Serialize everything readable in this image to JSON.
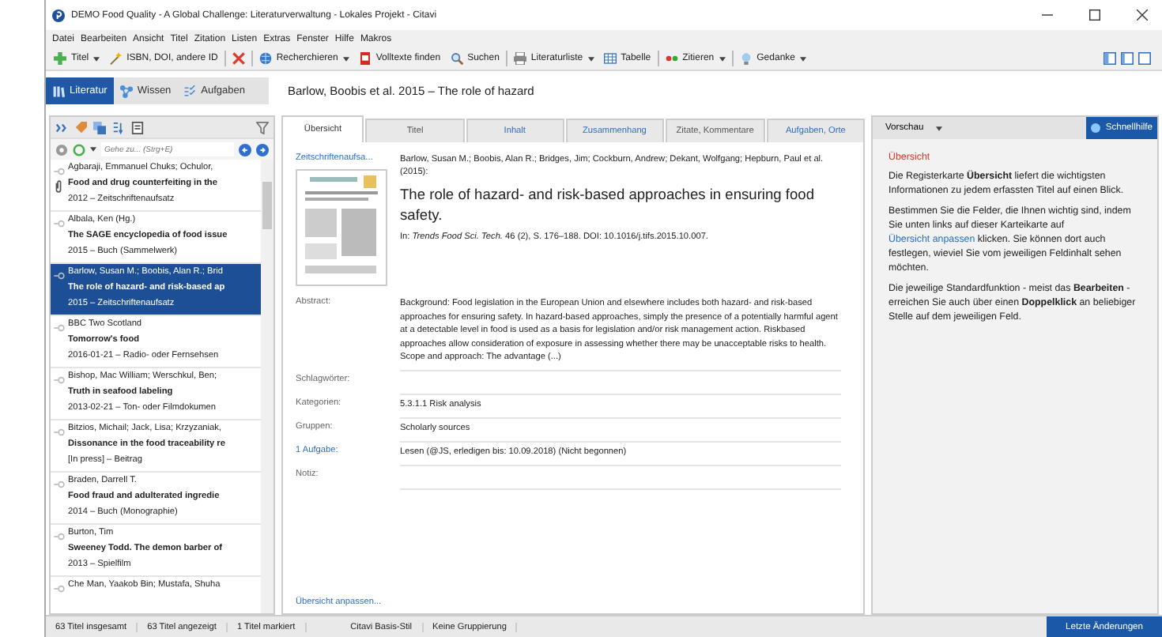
{
  "window": {
    "title": "DEMO Food Quality - A Global Challenge: Literaturverwaltung - Lokales Projekt - Citavi"
  },
  "menu": [
    "Datei",
    "Bearbeiten",
    "Ansicht",
    "Titel",
    "Zitation",
    "Listen",
    "Extras",
    "Fenster",
    "Hilfe",
    "Makros"
  ],
  "toolbar": [
    {
      "label": "Titel",
      "dropdown": true
    },
    {
      "label": "ISBN, DOI, andere ID",
      "dropdown": false
    },
    {
      "dropdown": false
    },
    {
      "label": "Recherchieren",
      "dropdown": true
    },
    {
      "label": "Volltexte finden",
      "dropdown": false
    },
    {
      "label": "Suchen",
      "dropdown": false
    },
    {
      "label": "Literaturliste",
      "dropdown": true
    },
    {
      "label": "Tabelle",
      "dropdown": false
    },
    {
      "label": "Zitieren",
      "dropdown": true
    },
    {
      "label": "Gedanke",
      "dropdown": true
    }
  ],
  "sections": [
    {
      "label": "Literatur",
      "selected": true
    },
    {
      "label": "Wissen",
      "selected": false
    },
    {
      "label": "Aufgaben",
      "selected": false
    }
  ],
  "heading": "Barlow, Boobis et al. 2015 – The role of hazard",
  "search": {
    "placeholder": "Gehe zu... (Strg+E)"
  },
  "references": [
    {
      "author": "Agbaraji, Emmanuel Chuks; Ochulor,",
      "title": "Food and drug counterfeiting in the",
      "meta": "2012 – Zeitschriftenaufsatz",
      "attachment": true,
      "selected": false
    },
    {
      "author": "Albala, Ken (Hg.)",
      "title": "The SAGE encyclopedia of food issue",
      "meta": "2015 – Buch (Sammelwerk)",
      "attachment": false,
      "selected": false
    },
    {
      "author": "Barlow, Susan M.; Boobis, Alan R.; Brid",
      "title": "The role of hazard- and risk-based ap",
      "meta": "2015 – Zeitschriftenaufsatz",
      "attachment": false,
      "selected": true
    },
    {
      "author": "BBC Two Scotland",
      "title": "Tomorrow's food",
      "meta": "2016-01-21 – Radio- oder Fernsehsen",
      "attachment": false,
      "selected": false
    },
    {
      "author": "Bishop, Mac William; Werschkul, Ben;",
      "title": "Truth in seafood labeling",
      "meta": "2013-02-21 – Ton- oder Filmdokumen",
      "attachment": false,
      "selected": false
    },
    {
      "author": "Bitzios, Michail; Jack, Lisa; Krzyzaniak,",
      "title": "Dissonance in the food traceability re",
      "meta": "[In press] – Beitrag",
      "attachment": false,
      "selected": false
    },
    {
      "author": "Braden, Darrell T.",
      "title": "Food fraud and adulterated ingredie",
      "meta": "2014 – Buch (Monographie)",
      "attachment": false,
      "selected": false
    },
    {
      "author": "Burton, Tim",
      "title": "Sweeney Todd. The demon barber of",
      "meta": "2013 – Spielfilm",
      "attachment": false,
      "selected": false
    },
    {
      "author": "Che Man, Yaakob Bin; Mustafa, Shuha",
      "attachment": false,
      "selected": false
    }
  ],
  "tabs": [
    {
      "label": "Übersicht",
      "selected": true,
      "has_content": false
    },
    {
      "label": "Titel",
      "selected": false,
      "has_content": false
    },
    {
      "label": "Inhalt",
      "selected": false,
      "has_content": true
    },
    {
      "label": "Zusammenhang",
      "selected": false,
      "has_content": true
    },
    {
      "label": "Zitate, Kommentare",
      "selected": false,
      "has_content": false
    },
    {
      "label": "Aufgaben, Orte",
      "selected": false,
      "has_content": true
    }
  ],
  "overview": {
    "type_link": "Zeitschriftenaufsa...",
    "authors": "Barlow, Susan M.; Boobis, Alan R.; Bridges, Jim; Cockburn, Andrew; Dekant, Wolfgang; Hepburn, Paul et al. (2015):",
    "title": "The role of hazard- and risk-based approaches in ensuring food safety.",
    "source": "In: *Trends Food Sci. Tech.* 46 (2), S. 176–188. DOI: 10.1016/j.tifs.2015.10.007.",
    "fields": [
      {
        "label": "Abstract:",
        "value": "Background: Food legislation in the European Union and elsewhere includes both hazard- and risk-based approaches for ensuring safety. In hazard-based approaches, simply the presence of a potentially harmful agent at a detectable level in food is used as a basis for legislation and/or risk management action. Riskbased approaches allow consideration of exposure in assessing whether there may be unacceptable risks to health. Scope and approach: The advantage (...)",
        "link": false
      },
      {
        "label": "Schlagwörter:",
        "link": false
      },
      {
        "label": "Kategorien:",
        "value": "5.3.1.1 Risk analysis",
        "link": false
      },
      {
        "label": "Gruppen:",
        "value": "Scholarly sources",
        "link": false
      },
      {
        "label": "1 Aufgabe:",
        "value": "Lesen (@JS, erledigen bis: 10.09.2018) (Nicht begonnen)",
        "link": true
      },
      {
        "label": "Notiz:",
        "link": false
      }
    ],
    "customize": "Übersicht anpassen..."
  },
  "preview": {
    "dropdown": "Vorschau",
    "help_button": "Schnellhilfe"
  },
  "help": {
    "heading": "Übersicht",
    "paragraphs": [
      {
        "text": "Die Registerkarte **Übersicht** liefert die wichtigsten Informationen zu jedem erfassten Titel auf einen Blick."
      },
      {
        "text": "Bestimmen Sie die Felder, die Ihnen wichtig sind, indem Sie unten links auf dieser Karteikarte auf",
        "link": "Übersicht anpassen",
        "after": "klicken. Sie können dort auch festlegen, wieviel Sie vom jeweiligen Feldinhalt sehen möchten."
      },
      {
        "text": "Die jeweilige Standardfunktion - meist das **Bearbeiten** - erreichen Sie auch über einen **Doppelklick** an beliebiger Stelle auf dem jeweiligen Feld."
      }
    ]
  },
  "status_bar": {
    "items": [
      "63 Titel insgesamt",
      "63 Titel angezeigt",
      "1 Titel markiert",
      "Citavi Basis-Stil",
      "Keine Gruppierung"
    ],
    "button": "Letzte Änderungen"
  }
}
